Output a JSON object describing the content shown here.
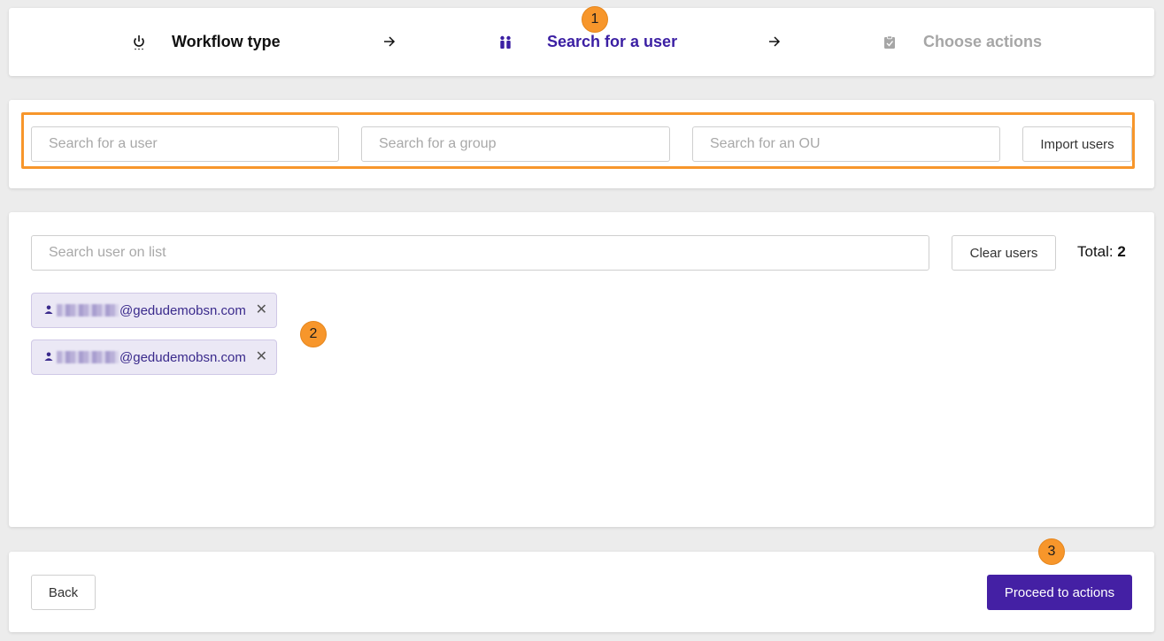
{
  "colors": {
    "accent": "#4420a4",
    "callout": "#f7962b",
    "active_step": "#3b1fa3",
    "inactive_step": "#a6a6a6"
  },
  "stepper": {
    "steps": [
      {
        "label": "Workflow type",
        "icon": "power-icon",
        "state": "done"
      },
      {
        "label": "Search for a user",
        "icon": "users-icon",
        "state": "active"
      },
      {
        "label": "Choose actions",
        "icon": "clipboard-icon",
        "state": "pending"
      }
    ],
    "separator_icon": "arrow-right-icon"
  },
  "search": {
    "user_placeholder": "Search for a user",
    "group_placeholder": "Search for a group",
    "ou_placeholder": "Search for an OU",
    "import_label": "Import users"
  },
  "user_list": {
    "filter_placeholder": "Search user on list",
    "clear_label": "Clear users",
    "total_label": "Total:",
    "total_value": "2",
    "users": [
      {
        "domain": "@gedudemobsn.com",
        "icon": "user-icon"
      },
      {
        "domain": "@gedudemobsn.com",
        "icon": "user-icon"
      }
    ]
  },
  "footer": {
    "back_label": "Back",
    "proceed_label": "Proceed to actions"
  },
  "callouts": [
    "1",
    "2",
    "3"
  ]
}
